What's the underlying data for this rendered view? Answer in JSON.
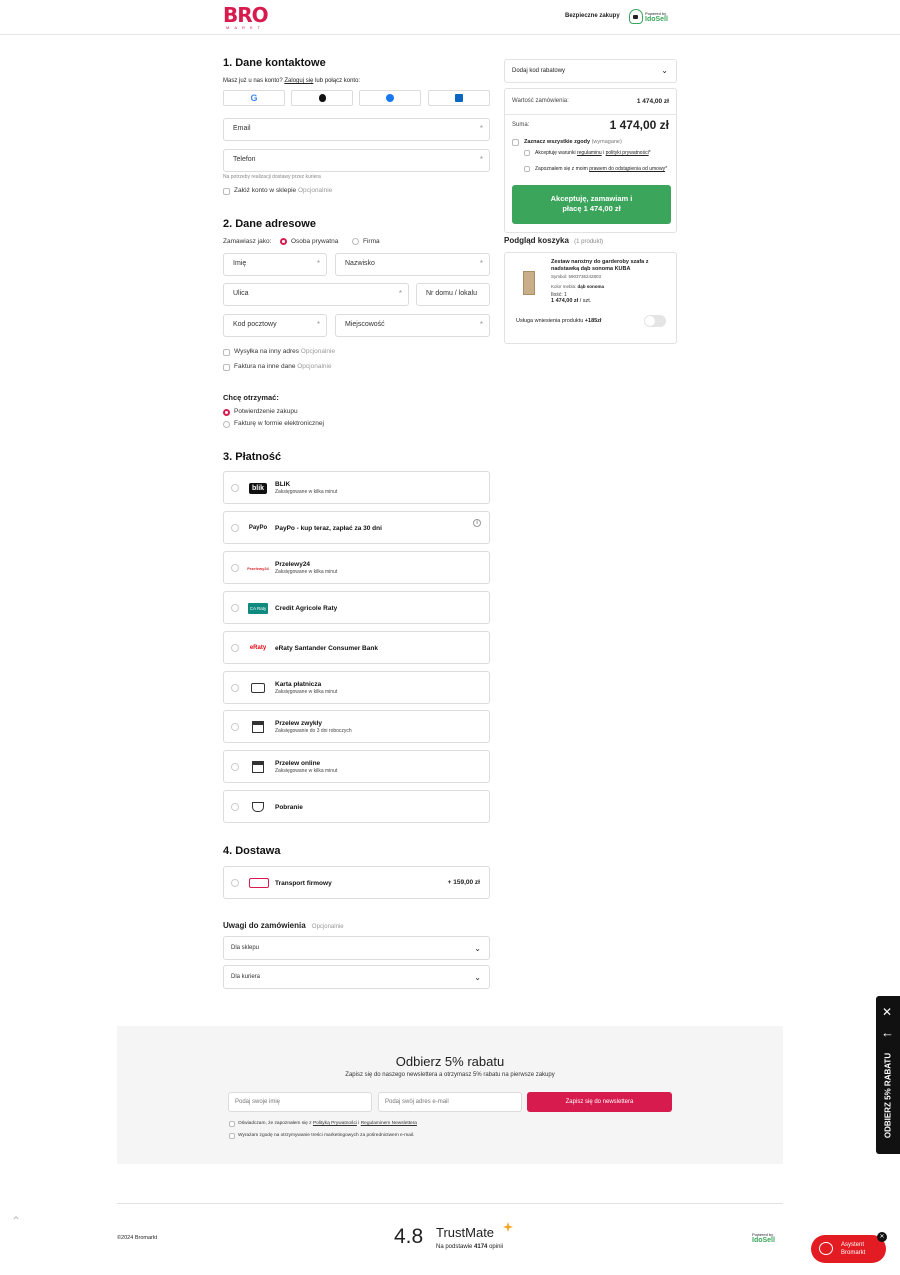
{
  "header": {
    "logo_big": "BRO",
    "logo_small": "MARKT",
    "secure": "Bezpieczne zakupy",
    "powered_by": "Powered by",
    "idosell": "IdoSell"
  },
  "contact": {
    "title": "1. Dane kontaktowe",
    "login_prompt": "Masz już u nas konto?",
    "login_link": "Zaloguj się",
    "login_suffix": "lub połącz konto:",
    "email": "Email",
    "phone": "Telefon",
    "phone_hint": "Na potrzeby realizacji dostawy przez kuriera",
    "create_account": "Załóż konto w sklepie",
    "optional": "Opcjonalnie",
    "req": "*"
  },
  "address": {
    "title": "2. Dane adresowe",
    "order_as": "Zamawiasz jako:",
    "private": "Osoba prywatna",
    "company": "Firma",
    "first_name": "Imię",
    "last_name": "Nazwisko",
    "street": "Ulica",
    "house": "Nr domu / lokalu",
    "postal": "Kod pocztowy",
    "city": "Miejscowość",
    "other_ship": "Wysyłka na inny adres",
    "other_invoice": "Faktura na inne dane",
    "optional": "Opcjonalnie"
  },
  "receive": {
    "title": "Chcę otrzymać:",
    "confirm": "Potwierdzenie zakupu",
    "invoice": "Fakturę w formie elektronicznej"
  },
  "payment": {
    "title": "3. Płatność",
    "methods": [
      {
        "name": "BLIK",
        "sub": "Zaksięgowane w kilka minut",
        "icon": "blik"
      },
      {
        "name": "PayPo - kup teraz, zapłać za 30 dni",
        "sub": "",
        "icon": "PayPo"
      },
      {
        "name": "Przelewy24",
        "sub": "Zaksięgowane w kilka minut",
        "icon": "Przelewy24"
      },
      {
        "name": "Credit Agricole Raty",
        "sub": "",
        "icon": "CA Raty"
      },
      {
        "name": "eRaty Santander Consumer Bank",
        "sub": "",
        "icon": "eRaty"
      },
      {
        "name": "Karta płatnicza",
        "sub": "Zaksięgowane w kilka minut",
        "icon": "card"
      },
      {
        "name": "Przelew zwykły",
        "sub": "Zaksięgowanie do 3 dni roboczych",
        "icon": "transfer"
      },
      {
        "name": "Przelew online",
        "sub": "Zaksięgowane w kilka minut",
        "icon": "online"
      },
      {
        "name": "Pobranie",
        "sub": "",
        "icon": "cash"
      }
    ],
    "info": "i"
  },
  "delivery": {
    "title": "4. Dostawa",
    "name": "Transport firmowy",
    "price": "+ 159,00 zł"
  },
  "notes": {
    "title": "Uwagi do zamówienia",
    "optional": "Opcjonalnie",
    "shop": "Dla sklepu",
    "courier": "Dla kuriera"
  },
  "summary": {
    "discount": "Dodaj kod rabatowy",
    "order_value_label": "Wartość zamówienia:",
    "order_value": "1 474,00 zł",
    "sum_label": "Suma:",
    "sum": "1 474,00 zł",
    "all_consents": "Zaznacz wszystkie zgody",
    "required": "(wymagane)",
    "accept_terms_pre": "Akceptuję warunki",
    "terms_link": "regulaminu",
    "and": "i",
    "privacy_link": "polityki prywatności",
    "withdraw_pre": "Zapoznałem się z moim",
    "withdraw_link": "prawem do odstąpienia od umowy",
    "star": "*",
    "button_line1": "Akceptuję, zamawiam i",
    "button_line2": "płacę 1 474,00 zł"
  },
  "cart": {
    "title": "Podgląd koszyka",
    "count": "(1 produkt)",
    "product_name": "Zestaw narożny do garderoby szafa z nadstawką dąb sonoma KUBA",
    "symbol": "Symbol: 5903736242803",
    "color_label": "Kolor mebla:",
    "color_value": "dąb sonoma",
    "qty": "Ilość: 1",
    "price": "1 474,00 zł",
    "per": "/ szt.",
    "service": "Usługa wniesienia produktu",
    "service_price": "+185zł"
  },
  "newsletter": {
    "title": "Odbierz 5% rabatu",
    "subtitle": "Zapisz się do naszego newslettera a otrzymasz 5% rabatu na pierwsze zakupy",
    "name_ph": "Podaj swoje imię",
    "email_ph": "Podaj swój adres e-mail",
    "button": "Zapisz się do newslettera",
    "consent1_pre": "Oświadczam, że zapoznałem się z",
    "consent1_link1": "Polityką Prywatności",
    "consent1_mid": "i",
    "consent1_link2": "Regulaminem Newslettera",
    "consent2": "Wyrażam zgodę na otrzymywanie treści marketingowych za pośrednictwem e-mail."
  },
  "side_tab": {
    "text": "ODBIERZ 5% RABATU"
  },
  "footer": {
    "copyright": "©2024 Bromarkt",
    "rating": "4.8",
    "trustmate": "TrustMate",
    "based_pre": "Na podstawie",
    "based_count": "4174",
    "based_suf": "opinii",
    "powered_by": "Powered by",
    "idosell": "IdoSell"
  },
  "assistant": {
    "line1": "Asystent",
    "line2": "Bromarkt"
  },
  "colors": {
    "accent": "#d81b4e",
    "green": "#3aa55b"
  }
}
